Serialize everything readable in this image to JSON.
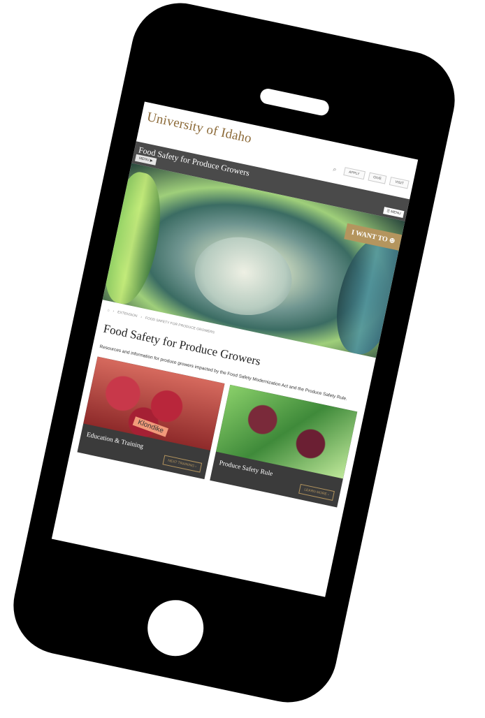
{
  "header": {
    "logo": "University of Idaho",
    "apply": "APPLY",
    "give": "GIVE",
    "visit": "VISIT"
  },
  "sitebar": {
    "title": "Food Safety for Produce Growers",
    "menu_left": "MENU ▶",
    "menu_right": "MENU"
  },
  "hero": {
    "i_want_to": "I WANT TO ⊕"
  },
  "breadcrumb": {
    "home_icon": "home-icon",
    "items": [
      "EXTENSION",
      "FOOD SAFETY FOR PRODUCE GROWERS"
    ]
  },
  "main": {
    "title": "Food Safety for Produce Growers",
    "description": "Resources and information for produce growers impacted by the Food Safety Modernization Act and the Produce Safety Rule."
  },
  "cards": [
    {
      "label": "Education & Training",
      "cta": "NEXT TRAINING ›",
      "tag": "Klondike"
    },
    {
      "label": "Produce Safety Rule",
      "cta": "LEARN MORE ›"
    }
  ],
  "colors": {
    "brand_gold": "#b4955e",
    "bar_gray": "#4a4a4a",
    "phone": "#000000"
  }
}
